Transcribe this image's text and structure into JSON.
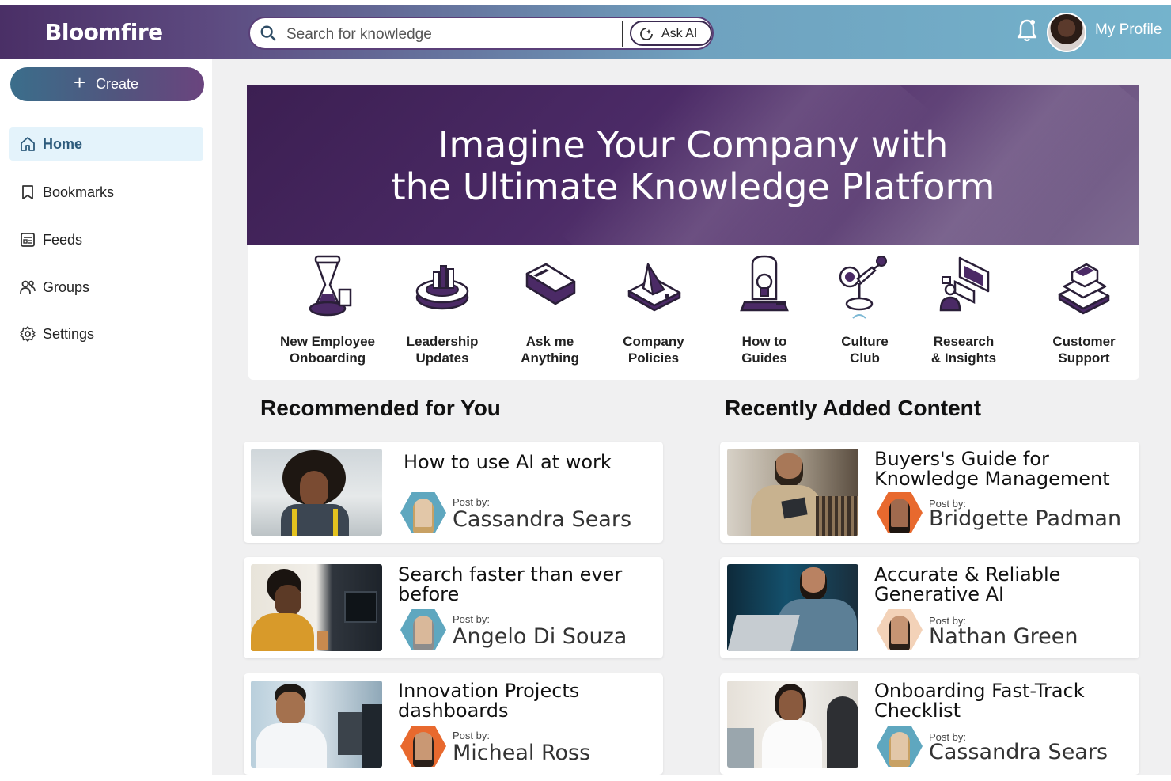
{
  "app": {
    "logo": "Bloomfire"
  },
  "search": {
    "placeholder": "Search for knowledge",
    "ask_ai_label": "Ask AI"
  },
  "header": {
    "profile_label": "My Profile"
  },
  "sidebar": {
    "create_label": "Create",
    "items": [
      {
        "label": "Home",
        "icon": "home-icon",
        "active": true
      },
      {
        "label": "Bookmarks",
        "icon": "bookmark-icon",
        "active": false
      },
      {
        "label": "Feeds",
        "icon": "feeds-icon",
        "active": false
      },
      {
        "label": "Groups",
        "icon": "groups-icon",
        "active": false
      },
      {
        "label": "Settings",
        "icon": "gear-icon",
        "active": false
      }
    ]
  },
  "hero": {
    "line1": "Imagine Your Company with",
    "line2": "the Ultimate Knowledge Platform"
  },
  "categories": [
    {
      "line1": "New Employee",
      "line2": "Onboarding",
      "icon": "hourglass-icon"
    },
    {
      "line1": "Leadership",
      "line2": "Updates",
      "icon": "chart-dial-icon"
    },
    {
      "line1": "Ask me",
      "line2": "Anything",
      "icon": "chat-block-icon"
    },
    {
      "line1": "Company",
      "line2": "Policies",
      "icon": "pyramid-icon"
    },
    {
      "line1": "How to",
      "line2": "Guides",
      "icon": "lightbulb-icon"
    },
    {
      "line1": "Culture",
      "line2": "Club",
      "icon": "lamp-icon"
    },
    {
      "line1": "Research",
      "line2": "& Insights",
      "icon": "research-icon"
    },
    {
      "line1": "Customer",
      "line2": "Support",
      "icon": "books-icon"
    }
  ],
  "recommended": {
    "title": "Recommended for You",
    "cards": [
      {
        "title": "How to use AI at work",
        "post_by": "Post by:",
        "author": "Cassandra Sears"
      },
      {
        "title": "Search faster than ever before",
        "post_by": "Post by:",
        "author": "Angelo Di Souza"
      },
      {
        "title": "Innovation Projects dashboards",
        "post_by": "Post by:",
        "author": "Micheal Ross"
      }
    ]
  },
  "recent": {
    "title": "Recently Added Content",
    "cards": [
      {
        "title": "Buyers's Guide for Knowledge Management",
        "post_by": "Post by:",
        "author": "Bridgette Padman"
      },
      {
        "title": "Accurate & Reliable Generative AI",
        "post_by": "Post by:",
        "author": "Nathan Green"
      },
      {
        "title": "Onboarding Fast-Track Checklist",
        "post_by": "Post by:",
        "author": "Cassandra Sears"
      }
    ]
  },
  "colors": {
    "brand_purple": "#4a2f66",
    "brand_teal": "#74b3cc",
    "active_nav_bg": "#e4f3fb",
    "hex_teal": "#5fa7bf",
    "hex_orange": "#e8692e"
  }
}
